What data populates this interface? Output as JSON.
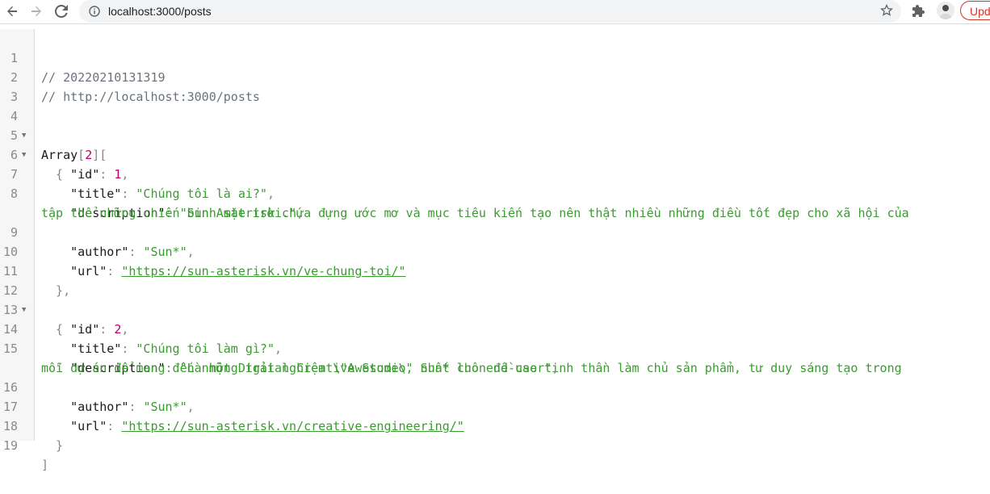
{
  "browser": {
    "url": "localhost:3000/posts",
    "update_label": "Update"
  },
  "viewer": {
    "comment_line_1": "// 20220210131319",
    "comment_line_2": "// http://localhost:3000/posts",
    "array_label": "Array",
    "array_count": "2",
    "posts": [
      {
        "id": "1",
        "title": "\"Chúng tôi là ai?\"",
        "description_part1": "\"Sun Asterisk chứa đựng ước mơ và mục tiêu kiến tạo nên thật nhiều những điều tốt đẹp cho xã hội của",
        "description_part2": "tập thể những chiến binh mặt trời.\"",
        "author": "\"Sun*\"",
        "url": "\"https://sun-asterisk.vn/ve-chung-toi/\""
      },
      {
        "id": "2",
        "title": "\"Chúng tôi làm gì?\"",
        "description_part1": "\"Là một Digital Creative Studio, Sun* luôn đề cao tinh thần làm chủ sản phẩm, tư duy sáng tạo trong",
        "description_part2": "mỗi dự án để mang đến những trải nghiệm \\\"Awesome\\\" nhất cho end-user\"",
        "author": "\"Sun*\"",
        "url": "\"https://sun-asterisk.vn/creative-engineering/\""
      }
    ],
    "line_numbers": [
      "1",
      "2",
      "3",
      "4",
      "5",
      "6",
      "7",
      "8",
      "9",
      "10",
      "11",
      "12",
      "13",
      "14",
      "15",
      "16",
      "17",
      "18",
      "19"
    ]
  }
}
